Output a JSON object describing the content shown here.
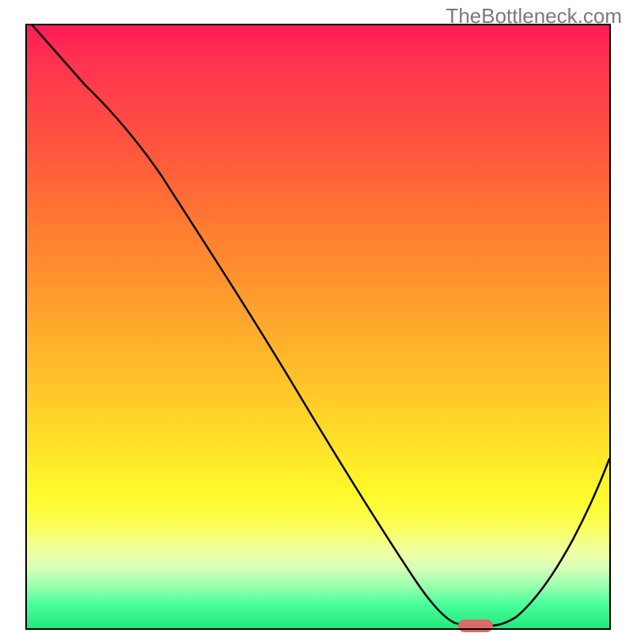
{
  "watermark": "TheBottleneck.com",
  "chart_data": {
    "type": "line",
    "title": "",
    "xlabel": "",
    "ylabel": "",
    "xlim": [
      0,
      100
    ],
    "ylim": [
      0,
      100
    ],
    "x": [
      1,
      10,
      21,
      30,
      40,
      50,
      60,
      66,
      70,
      73,
      77,
      80,
      85,
      90,
      95,
      100
    ],
    "values": [
      100,
      90,
      78,
      67,
      51,
      36,
      20,
      10,
      5,
      2,
      0.5,
      0.5,
      1.5,
      8,
      17,
      28
    ],
    "note": "V-shaped bottleneck curve over red→green vertical gradient; minimum (optimal) region highlighted near x≈77–80",
    "marker": {
      "x_start": 77,
      "x_end": 82,
      "y": 0.5,
      "color": "#db6b6b"
    },
    "gradient_stops": [
      {
        "pos": 0,
        "color": "#ff1a56"
      },
      {
        "pos": 50,
        "color": "#ffa92c"
      },
      {
        "pos": 78,
        "color": "#fffb2a"
      },
      {
        "pos": 100,
        "color": "#22e87a"
      }
    ]
  }
}
